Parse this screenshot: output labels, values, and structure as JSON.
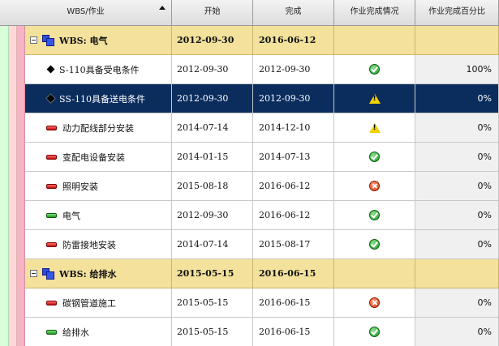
{
  "header": {
    "name": "WBS/作业",
    "start": "开始",
    "end": "完成",
    "status": "作业完成情况",
    "percent": "作业完成百分比"
  },
  "stripe_colors": [
    "#d8ffd8",
    "#ffd8d8",
    "#f7b4c4",
    "#ece3a8"
  ],
  "rows": [
    {
      "type": "wbs",
      "name": "WBS: 电气",
      "start": "2012-09-30",
      "end": "2016-06-12",
      "status": "",
      "percent": ""
    },
    {
      "type": "milestone",
      "name": "S-110具备受电条件",
      "start": "2012-09-30",
      "end": "2012-09-30",
      "status": "ok",
      "percent": "100%"
    },
    {
      "type": "milestone",
      "name": "SS-110具备送电条件",
      "start": "2012-09-30",
      "end": "2012-09-30",
      "status": "warn",
      "percent": "0%",
      "selected": true
    },
    {
      "type": "task-red",
      "name": "动力配线部分安装",
      "start": "2014-07-14",
      "end": "2014-12-10",
      "status": "warn",
      "percent": "0%"
    },
    {
      "type": "task-red",
      "name": "变配电设备安装",
      "start": "2014-01-15",
      "end": "2014-07-13",
      "status": "ok",
      "percent": "0%"
    },
    {
      "type": "task-red",
      "name": "照明安装",
      "start": "2015-08-18",
      "end": "2016-06-12",
      "status": "error",
      "percent": "0%"
    },
    {
      "type": "task-green",
      "name": "电气",
      "start": "2012-09-30",
      "end": "2016-06-12",
      "status": "ok",
      "percent": "0%"
    },
    {
      "type": "task-red",
      "name": "防雷接地安装",
      "start": "2014-07-14",
      "end": "2015-08-17",
      "status": "ok",
      "percent": "0%"
    },
    {
      "type": "wbs",
      "name": "WBS: 给排水",
      "start": "2015-05-15",
      "end": "2016-06-15",
      "status": "",
      "percent": ""
    },
    {
      "type": "task-red",
      "name": "碳钢管道施工",
      "start": "2015-05-15",
      "end": "2016-06-15",
      "status": "error",
      "percent": "0%"
    },
    {
      "type": "task-green",
      "name": "给排水",
      "start": "2015-05-15",
      "end": "2016-06-15",
      "status": "ok",
      "percent": "0%"
    }
  ]
}
